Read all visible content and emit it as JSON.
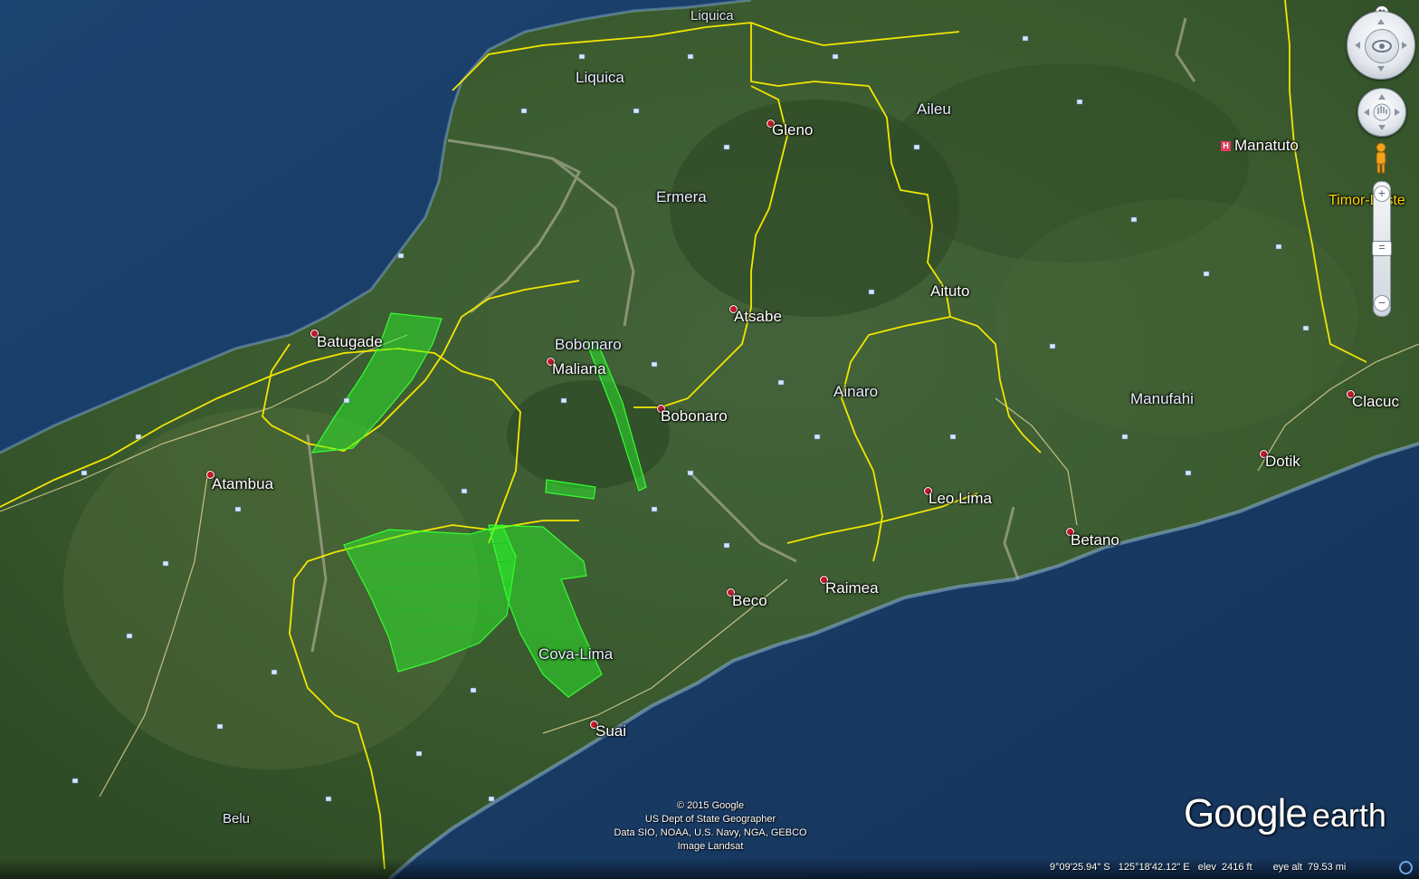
{
  "map": {
    "type": "satellite",
    "application": "Google Earth",
    "place_labels": {
      "liquica_town": "Liquica",
      "liquica_district": "Liquica",
      "aileu": "Aileu",
      "gleno": "Gleno",
      "ermera": "Ermera",
      "manatuto": "Manatuto",
      "timor_leste": "Timor-Leste",
      "aituto": "Aituto",
      "atsabe": "Atsabe",
      "batugade": "Batugade",
      "bobonaro_district": "Bobonaro",
      "maliana": "Maliana",
      "bobonaro_town": "Bobonaro",
      "ainaro": "Ainaro",
      "manufahi": "Manufahi",
      "clacuc": "Clacuc",
      "atambua": "Atambua",
      "dotik": "Dotik",
      "leo_lima": "Leo Lima",
      "betano": "Betano",
      "raimea": "Raimea",
      "beco": "Beco",
      "cova_lima": "Cova-Lima",
      "suai": "Suai",
      "belu": "Belu"
    },
    "colors": {
      "sea": "#173a63",
      "land": "#3f5c2e",
      "border": "#f2e600",
      "overlay": "#2bff2b"
    }
  },
  "controls": {
    "north_label": "N",
    "zoom_in": "+",
    "zoom_out": "−",
    "zoom_slider": "="
  },
  "attribution": {
    "line1": "© 2015 Google",
    "line2": "US Dept of State Geographer",
    "line3": "Data SIO, NOAA, U.S. Navy, NGA, GEBCO",
    "line4": "Image Landsat"
  },
  "logo": {
    "google": "Google",
    "earth": "earth"
  },
  "status": {
    "latitude": "9°09'25.94\" S",
    "longitude": "125°18'42.12\" E",
    "elev_label": "elev",
    "elevation": "2416 ft",
    "eye_alt_label": "eye alt",
    "eye_alt": "79.53 mi"
  }
}
